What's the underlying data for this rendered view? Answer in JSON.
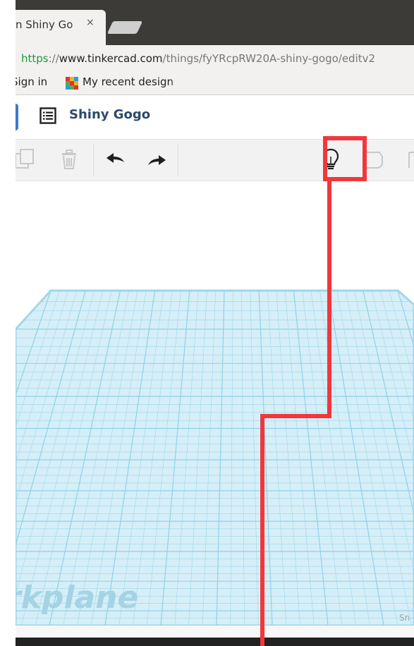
{
  "browser": {
    "tab_title": "n Shiny Go",
    "tab_close": "×",
    "url_scheme": "https",
    "url_sep": "://",
    "url_host": "www.tinkercad.com",
    "url_path": "/things/fyYRcpRW20A-shiny-gogo/editv2"
  },
  "bookmarks": {
    "sign_in": "Sign in",
    "recent_designs": "My recent design"
  },
  "app": {
    "design_title": "Shiny Gogo"
  },
  "workplane": {
    "label": "rkplane",
    "snap_label": "Sn"
  },
  "colors": {
    "annotation": "#f2373a",
    "grid": "#8fd2ea",
    "header_blue": "#3f79c9"
  }
}
